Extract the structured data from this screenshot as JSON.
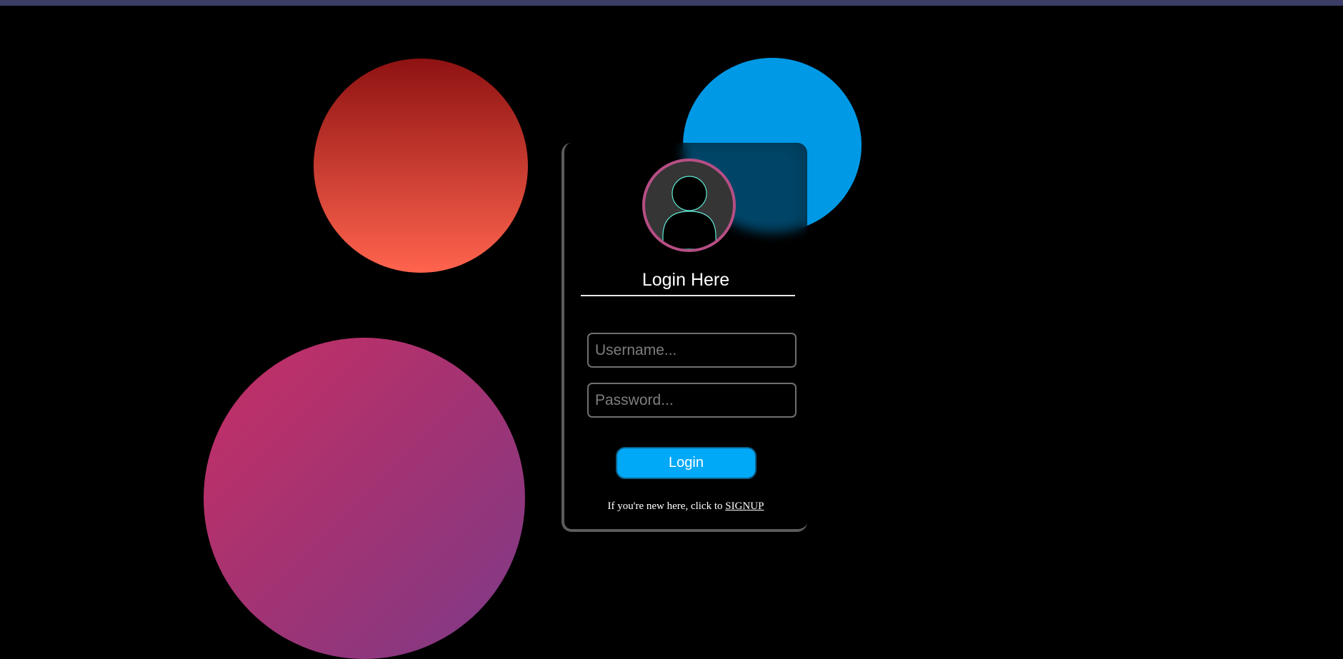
{
  "colors": {
    "accent_blue": "#00a8f8",
    "avatar_ring": "#b64e84",
    "avatar_icon_stroke": "#5eead4",
    "background": "#000000"
  },
  "login": {
    "title": "Login Here",
    "username_placeholder": "Username...",
    "password_placeholder": "Password...",
    "submit_label": "Login",
    "signup_prefix": "If you're new here, click to",
    "signup_link": "SIGNUP"
  },
  "icons": {
    "avatar": "user-icon"
  }
}
